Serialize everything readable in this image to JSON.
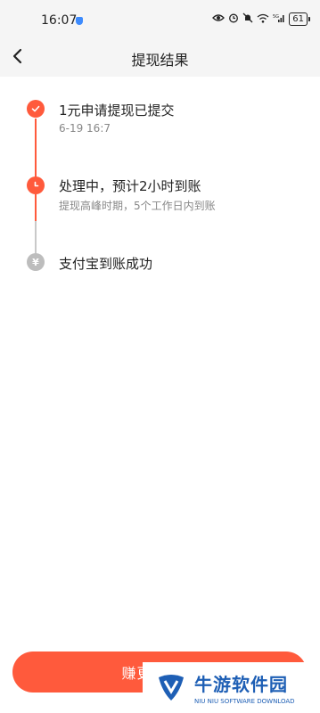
{
  "status_bar": {
    "time": "16:07",
    "signal_label": "5G",
    "battery": "61"
  },
  "header": {
    "title": "提现结果"
  },
  "steps": [
    {
      "title": "1元申请提现已提交",
      "subtitle": "6-19 16:7",
      "state": "done"
    },
    {
      "title": "处理中，预计2小时到账",
      "subtitle": "提现高峰时期，5个工作日内到账",
      "state": "processing"
    },
    {
      "title": "支付宝到账成功",
      "subtitle": "",
      "state": "pending",
      "icon_glyph": "¥"
    }
  ],
  "footer": {
    "button_label": "赚更多现金"
  },
  "watermark": {
    "name_cn": "牛游软件园",
    "name_en": "NIU NIU SOFTWARE DOWNLOAD"
  },
  "colors": {
    "accent": "#ff5a3c",
    "pending": "#bdbdbd",
    "brand_blue": "#1e5fb5"
  }
}
